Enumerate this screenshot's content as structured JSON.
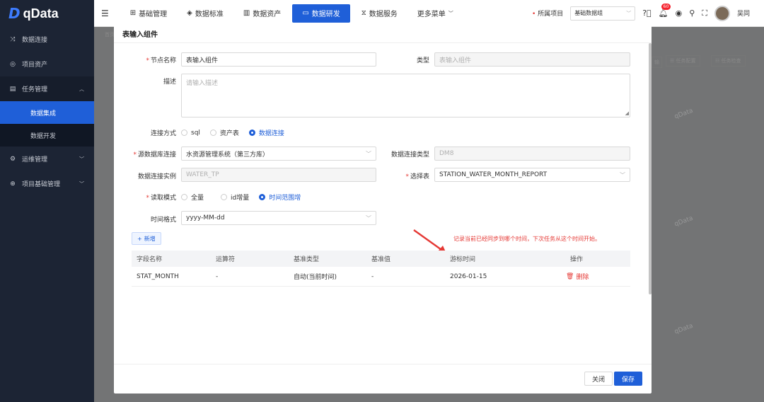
{
  "app": {
    "logo_mark": "D",
    "logo_text": "qData"
  },
  "sidebar": {
    "items": [
      {
        "label": "数据连接",
        "icon": "link-icon"
      },
      {
        "label": "项目资产",
        "icon": "asset-icon"
      },
      {
        "label": "任务管理",
        "icon": "task-icon"
      },
      {
        "label": "数据集成",
        "sub": true,
        "active": true
      },
      {
        "label": "数据开发",
        "sub": true
      },
      {
        "label": "运维管理",
        "icon": "ops-icon"
      },
      {
        "label": "项目基础管理",
        "icon": "globe-icon"
      }
    ]
  },
  "topbar": {
    "nav": [
      {
        "label": "基础管理"
      },
      {
        "label": "数据标准"
      },
      {
        "label": "数据资产"
      },
      {
        "label": "数据研发",
        "active": true
      },
      {
        "label": "数据服务"
      },
      {
        "label": "更多菜单"
      }
    ],
    "project_label": "所属项目",
    "project_value": "基础数据组",
    "badge": "60",
    "user": "吴同"
  },
  "background": {
    "breadcrumb": "首页",
    "btn1": "任务配置",
    "btn2": "任务检查",
    "btn0": "输"
  },
  "modal": {
    "title": "表输入组件",
    "node_name_label": "节点名称",
    "node_name_value": "表输入组件",
    "type_label": "类型",
    "type_value": "表输入组件",
    "desc_label": "描述",
    "desc_placeholder": "请输入描述",
    "conn_mode_label": "连接方式",
    "conn_mode_options": [
      "sql",
      "资产表",
      "数据连接"
    ],
    "source_db_label": "源数据库连接",
    "source_db_value": "水资源管理系统（第三方库）",
    "db_type_label": "数据连接类型",
    "db_type_value": "DM8",
    "db_instance_label": "数据连接实例",
    "db_instance_value": "WATER_TP",
    "table_label": "选择表",
    "table_value": "STATION_WATER_MONTH_REPORT",
    "read_mode_label": "读取模式",
    "read_mode_options": [
      "全量",
      "id增量",
      "时间范围增"
    ],
    "time_format_label": "时间格式",
    "time_format_value": "yyyy-MM-dd",
    "add_label": "新增",
    "note": "记录当前已经同步到哪个时间，下次任务从这个时间开始。",
    "columns": [
      "字段名称",
      "运算符",
      "基准类型",
      "基准值",
      "游标时间",
      "操作"
    ],
    "rows": [
      {
        "field": "STAT_MONTH",
        "op": "-",
        "base_type": "自动(当前时间)",
        "base_val": "-",
        "cursor": "2026-01-15",
        "action": "删除"
      }
    ],
    "close_label": "关闭",
    "save_label": "保存"
  },
  "watermark": "qData",
  "colors": {
    "primary": "#1f5fd8",
    "danger": "#e53935",
    "sidebar": "#1c2434"
  }
}
